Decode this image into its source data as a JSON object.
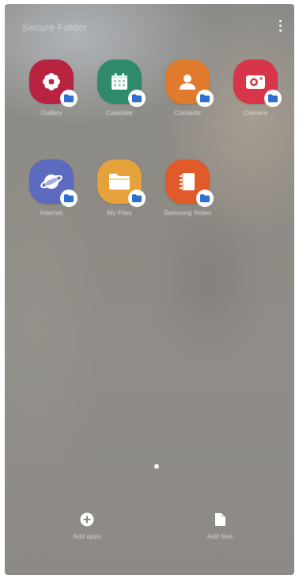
{
  "header": {
    "search_placeholder": "Secure Folder",
    "more_options_icon": "more-vert-icon"
  },
  "apps": [
    {
      "label": "Gallery",
      "icon": "gallery-flower-icon",
      "color": "#b8243f"
    },
    {
      "label": "Calendar",
      "icon": "calendar-icon",
      "color": "#2e8a6a"
    },
    {
      "label": "Contacts",
      "icon": "contacts-person-icon",
      "color": "#e07a2c"
    },
    {
      "label": "Camera",
      "icon": "camera-icon",
      "color": "#d8354a"
    },
    {
      "label": "Internet",
      "icon": "internet-planet-icon",
      "color": "#5c6ac0"
    },
    {
      "label": "My Files",
      "icon": "folder-icon",
      "color": "#e6a23a"
    },
    {
      "label": "Samsung Notes",
      "icon": "notes-icon",
      "color": "#e05a2a"
    }
  ],
  "pager": {
    "pages": 1,
    "current": 1
  },
  "bottom_actions": {
    "add_apps": "Add apps",
    "add_files": "Add files"
  },
  "colors": {
    "folder_badge": "#2f6fd1",
    "badge_background": "#ffffff"
  }
}
